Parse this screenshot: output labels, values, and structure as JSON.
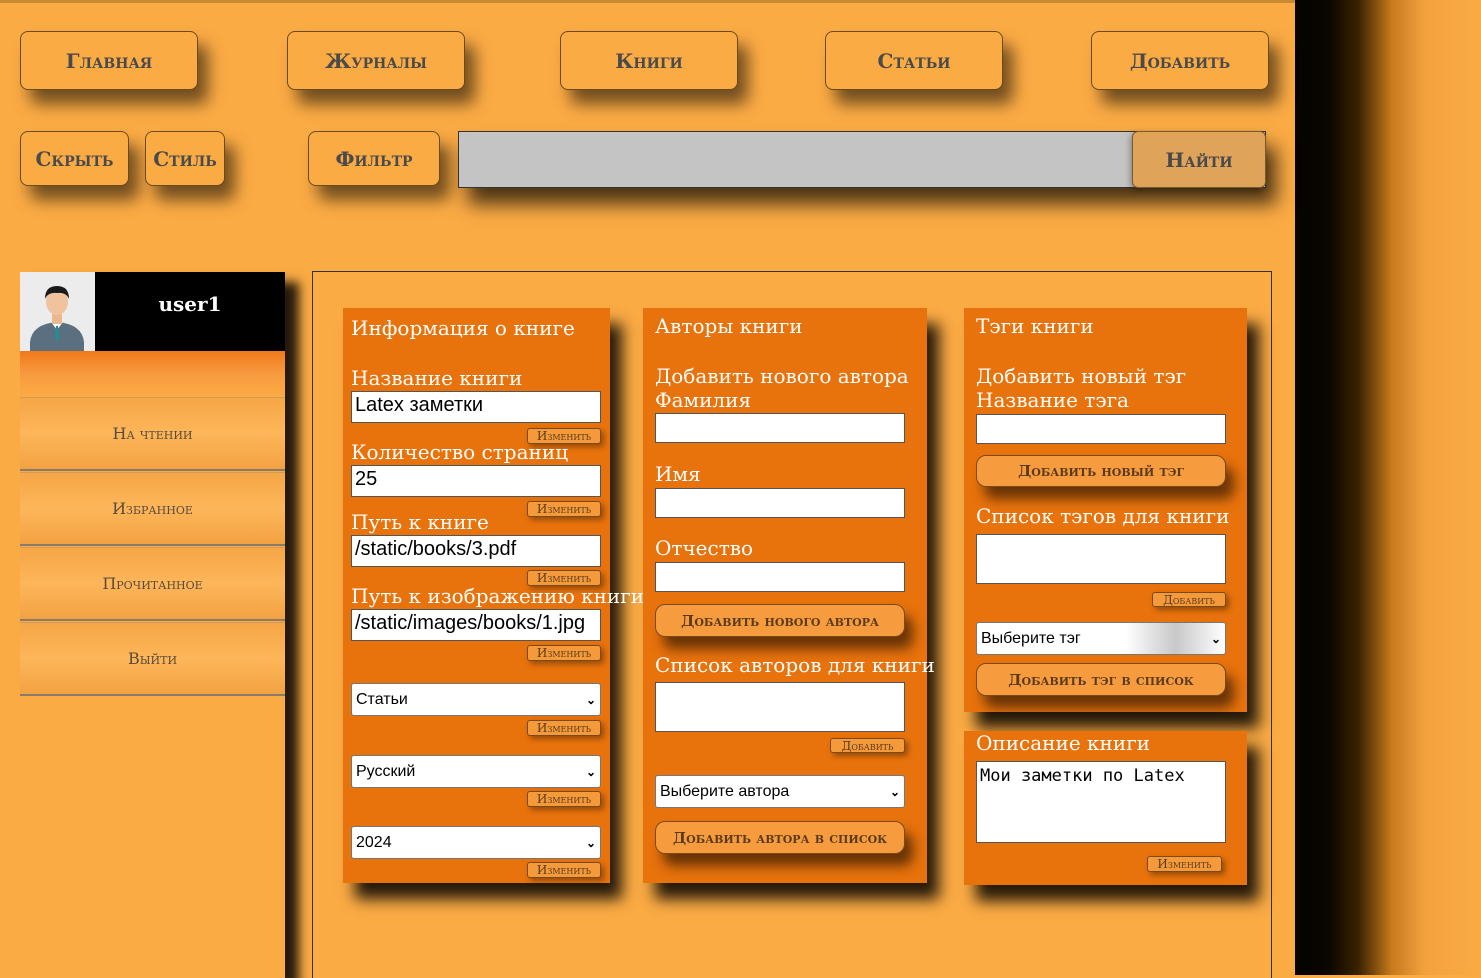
{
  "nav": {
    "home": "Главная",
    "journals": "Журналы",
    "books": "Книги",
    "articles": "Статьи",
    "add": "Добавить"
  },
  "toolbar": {
    "hide": "Скрыть",
    "style": "Стиль",
    "filter": "Фильтр",
    "search_value": "",
    "find": "Найти"
  },
  "sidebar": {
    "username": "user1",
    "items": [
      {
        "label": "На чтении"
      },
      {
        "label": "Избранное"
      },
      {
        "label": "Прочитанное"
      },
      {
        "label": "Выйти"
      }
    ]
  },
  "book_info": {
    "title": "Информация о книге",
    "name_label": "Название книги",
    "name_value": "Latex заметки",
    "pages_label": "Количество страниц",
    "pages_value": "25",
    "path_label": "Путь к книге",
    "path_value": "/static/books/3.pdf",
    "image_label": "Путь к изображению книги",
    "image_value": "/static/images/books/1.jpg",
    "type_value": "Статьи",
    "language_value": "Русский",
    "year_value": "2024",
    "change": "Изменить"
  },
  "authors": {
    "title": "Авторы книги",
    "add_new_label": "Добавить нового автора",
    "surname_label": "Фамилия",
    "name_label": "Имя",
    "patronymic_label": "Отчество",
    "add_new_button": "Добавить нового автора",
    "list_label": "Список авторов для книги",
    "add_button": "Добавить",
    "select_value": "Выберите автора",
    "add_to_list_button": "Добавить автора в список"
  },
  "tags": {
    "title": "Тэги книги",
    "add_new_label": "Добавить новый тэг",
    "name_label": "Название тэга",
    "add_new_button": "Добавить новый тэг",
    "list_label": "Список тэгов для книги",
    "add_button": "Добавить",
    "select_value": "Выберите тэг",
    "add_to_list_button": "Добавить тэг в список"
  },
  "description": {
    "title": "Описание книги",
    "value": "Мои заметки по Latex",
    "change": "Изменить"
  },
  "colors": {
    "background": "#fbab44",
    "card": "#e8720c",
    "search": "#c4c4c4"
  }
}
